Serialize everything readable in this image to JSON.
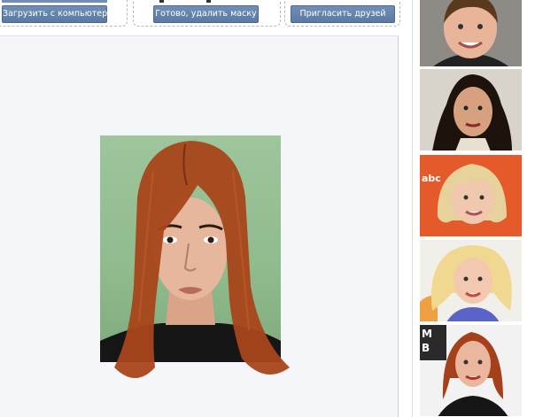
{
  "toolbar": {
    "upload_label": "Загрузить с компьютера",
    "done_label": "Готово, удалить маску",
    "invite_label": "Пригласить друзей"
  },
  "canvas": {
    "photo": "portrait-with-hairstyle-mask"
  },
  "gallery": {
    "items": [
      {
        "name": "thumbnail-boy",
        "hair_color": "#5a3a1c",
        "bg": "#8e8a86"
      },
      {
        "name": "thumbnail-dark-curly",
        "hair_color": "#1e120c",
        "bg": "#d8d4cc"
      },
      {
        "name": "thumbnail-blonde-bob",
        "hair_color": "#e6d29a",
        "bg": "#e55a2b"
      },
      {
        "name": "thumbnail-blonde-curly",
        "hair_color": "#f0d890",
        "bg": "#f1efea"
      },
      {
        "name": "thumbnail-red-hair",
        "hair_color": "#a5401c",
        "bg": "#2a2a2a"
      }
    ]
  },
  "colors": {
    "button": "#5a7aa1",
    "hair_mask": "#a8451a",
    "photo_bg": "#9ec59c",
    "canvas_bg": "#f4f6f9"
  }
}
